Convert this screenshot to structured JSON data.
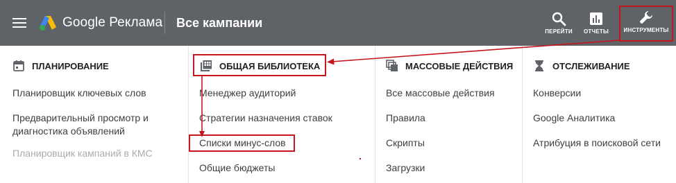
{
  "header": {
    "brand": "Google Реклама",
    "page_title": "Все кампании",
    "buttons": [
      {
        "label": "ПЕРЕЙТИ",
        "icon": "search-icon"
      },
      {
        "label": "ОТЧЕТЫ",
        "icon": "reports-icon"
      },
      {
        "label": "ИНСТРУМЕНТЫ",
        "icon": "wrench-icon"
      }
    ]
  },
  "columns": [
    {
      "heading": "ПЛАНИРОВАНИЕ",
      "icon": "calendar-icon",
      "items": [
        "Планировщик ключевых слов",
        "Предварительный просмотр и диагностика объявлений",
        "Планировщик кампаний в КМС"
      ]
    },
    {
      "heading": "ОБЩАЯ БИБЛИОТЕКА",
      "icon": "library-icon",
      "items": [
        "Менеджер аудиторий",
        "Стратегии назначения ставок",
        "Списки минус-слов",
        "Общие бюджеты"
      ]
    },
    {
      "heading": "МАССОВЫЕ ДЕЙСТВИЯ",
      "icon": "bulk-actions-icon",
      "items": [
        "Все массовые действия",
        "Правила",
        "Скрипты",
        "Загрузки"
      ]
    },
    {
      "heading": "ОТСЛЕЖИВАНИЕ",
      "icon": "hourglass-icon",
      "items": [
        "Конверсии",
        "Google Аналитика",
        "Атрибуция в поисковой сети"
      ]
    }
  ],
  "colors": {
    "topbar": "#5f6368",
    "annotation_red": "#c4161c",
    "text": "#3c4043",
    "disabled_text": "#a8acb0"
  }
}
